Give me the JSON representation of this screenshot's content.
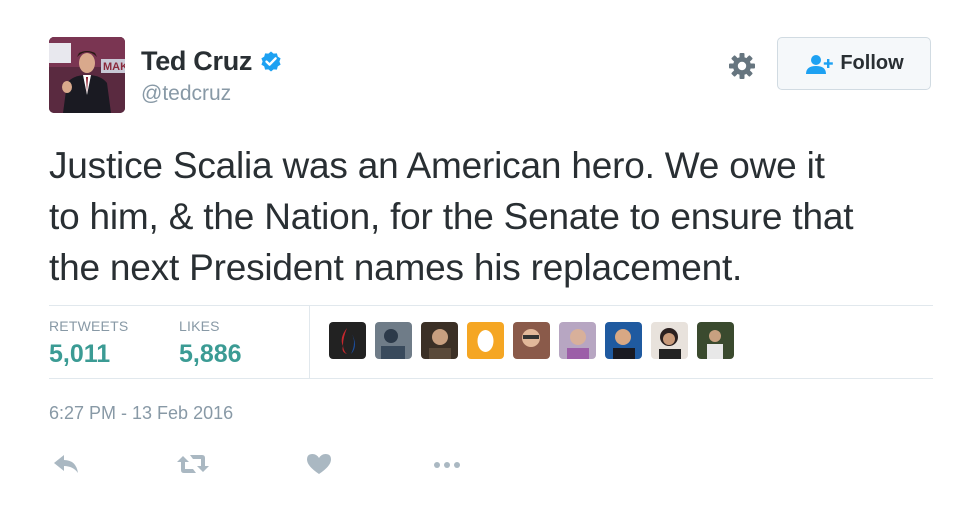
{
  "user": {
    "name": "Ted Cruz",
    "handle": "@tedcruz",
    "verified_icon": "verified-badge-icon",
    "avatar_sign_text": "MAK"
  },
  "follow_button": {
    "label": "Follow",
    "icon": "follow-person-icon"
  },
  "tweet": {
    "lines": [
      "Justice Scalia was an American hero. We owe it",
      "to him, & the Nation, for the Senate to ensure that",
      "the next President names his replacement."
    ]
  },
  "stats": {
    "retweets_label": "RETWEETS",
    "retweets_value": "5,011",
    "likes_label": "LIKES",
    "likes_value": "5,886"
  },
  "likers": [
    {
      "icon": "liker-avatar-flame-logo"
    },
    {
      "icon": "liker-avatar-person"
    },
    {
      "icon": "liker-avatar-person"
    },
    {
      "icon": "liker-avatar-default-egg"
    },
    {
      "icon": "liker-avatar-person"
    },
    {
      "icon": "liker-avatar-person"
    },
    {
      "icon": "liker-avatar-person"
    },
    {
      "icon": "liker-avatar-person"
    },
    {
      "icon": "liker-avatar-person"
    }
  ],
  "timestamp": "6:27 PM - 13 Feb 2016",
  "actions": [
    "reply-icon",
    "retweet-icon",
    "like-heart-icon",
    "more-icon"
  ],
  "colors": {
    "accent_link": "#1da1f2",
    "stat_value": "#3b9b94",
    "muted": "#8899a6",
    "text": "#292f33",
    "divider": "#e1e8ed"
  }
}
